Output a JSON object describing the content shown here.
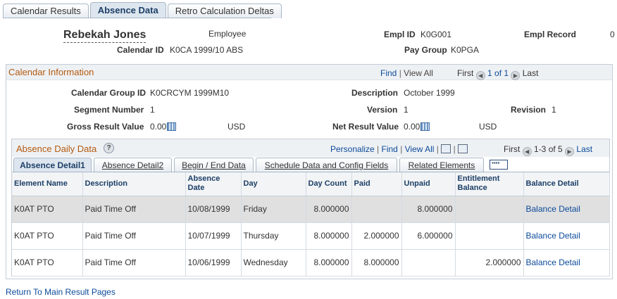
{
  "tabs": [
    {
      "label": "Calendar Results"
    },
    {
      "label": "Absence Data"
    },
    {
      "label": "Retro Calculation Deltas"
    }
  ],
  "employee": {
    "name": "Rebekah Jones",
    "type": "Employee",
    "empl_id_label": "Empl ID",
    "empl_id": "K0G001",
    "empl_record_label": "Empl Record",
    "empl_record": "0",
    "calendar_id_label": "Calendar ID",
    "calendar_id": "K0CA 1999/10 ABS",
    "pay_group_label": "Pay Group",
    "pay_group": "K0PGA"
  },
  "calendar_info": {
    "title": "Calendar Information",
    "find": "Find",
    "view_all": "View All",
    "first": "First",
    "range": "1 of 1",
    "last": "Last",
    "calendar_group_id_label": "Calendar Group ID",
    "calendar_group_id": "K0CRCYM 1999M10",
    "description_label": "Description",
    "description": "October 1999",
    "segment_number_label": "Segment Number",
    "segment_number": "1",
    "version_label": "Version",
    "version": "1",
    "revision_label": "Revision",
    "revision": "1",
    "gross_label": "Gross Result Value",
    "gross_value": "0.00",
    "gross_currency": "USD",
    "net_label": "Net Result Value",
    "net_value": "0.00",
    "net_currency": "USD"
  },
  "absence": {
    "title": "Absence Daily Data",
    "personalize": "Personalize",
    "find": "Find",
    "view_all": "View All",
    "first": "First",
    "range": "1-3 of 5",
    "last": "Last",
    "subtabs": [
      {
        "label": "Absence Detail1"
      },
      {
        "label": "Absence Detail2"
      },
      {
        "label": "Begin / End Data"
      },
      {
        "label": "Schedule Data and Config Fields"
      },
      {
        "label": "Related Elements"
      }
    ],
    "columns": [
      "Element Name",
      "Description",
      "Absence Date",
      "Day",
      "Day Count",
      "Paid",
      "Unpaid",
      "Entitlement Balance",
      "Balance Detail"
    ],
    "rows": [
      {
        "element": "K0AT PTO",
        "description": "Paid Time Off",
        "date": "10/08/1999",
        "day": "Friday",
        "day_count": "8.000000",
        "paid": "",
        "unpaid": "8.000000",
        "entitlement": "",
        "balance_detail": "Balance Detail"
      },
      {
        "element": "K0AT PTO",
        "description": "Paid Time Off",
        "date": "10/07/1999",
        "day": "Thursday",
        "day_count": "8.000000",
        "paid": "2.000000",
        "unpaid": "6.000000",
        "entitlement": "",
        "balance_detail": "Balance Detail"
      },
      {
        "element": "K0AT PTO",
        "description": "Paid Time Off",
        "date": "10/06/1999",
        "day": "Wednesday",
        "day_count": "8.000000",
        "paid": "8.000000",
        "unpaid": "",
        "entitlement": "2.000000",
        "balance_detail": "Balance Detail"
      }
    ]
  },
  "footer_link": "Return To Main Result Pages"
}
